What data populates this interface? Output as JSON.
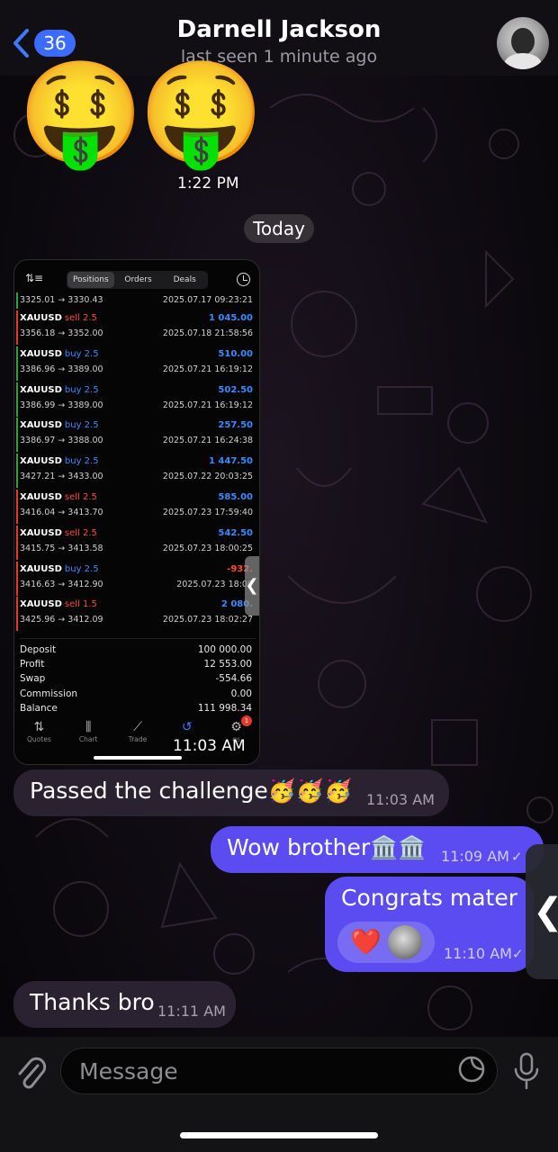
{
  "header": {
    "back_count": "36",
    "contact_name": "Darnell Jackson",
    "status": "last seen 1 minute ago",
    "avatar_icon": "contact-avatar"
  },
  "stickers": [
    "🤑",
    "🤑"
  ],
  "sticker_time": "1:22 PM",
  "date_divider": "Today",
  "photo_message": {
    "time": "11:03 AM",
    "tabs": [
      "Positions",
      "Orders",
      "Deals"
    ],
    "first_row": {
      "prices": "3325.01 → 3330.43",
      "date": "2025.07.17 09:23:21",
      "edge": "#2ea043"
    },
    "trades": [
      {
        "symbol": "XAUUSD",
        "dir": "sell 2.5",
        "dir_color": "#ff4b3e",
        "profit": "1 045.00",
        "profit_color": "#3b8bff",
        "prices": "3356.18 → 3352.00",
        "date": "2025.07.18 21:58:56",
        "edge": "#e5372c"
      },
      {
        "symbol": "XAUUSD",
        "dir": "buy 2.5",
        "dir_color": "#3b8bff",
        "profit": "510.00",
        "profit_color": "#3b8bff",
        "prices": "3386.96 → 3389.00",
        "date": "2025.07.21 16:19:12",
        "edge": "#2ea043"
      },
      {
        "symbol": "XAUUSD",
        "dir": "buy 2.5",
        "dir_color": "#3b8bff",
        "profit": "502.50",
        "profit_color": "#3b8bff",
        "prices": "3386.99 → 3389.00",
        "date": "2025.07.21 16:19:12",
        "edge": "#2ea043"
      },
      {
        "symbol": "XAUUSD",
        "dir": "buy 2.5",
        "dir_color": "#3b8bff",
        "profit": "257.50",
        "profit_color": "#3b8bff",
        "prices": "3386.97 → 3388.00",
        "date": "2025.07.21 16:24:38",
        "edge": "#2ea043"
      },
      {
        "symbol": "XAUUSD",
        "dir": "buy 2.5",
        "dir_color": "#3b8bff",
        "profit": "1 447.50",
        "profit_color": "#3b8bff",
        "prices": "3427.21 → 3433.00",
        "date": "2025.07.22 20:03:25",
        "edge": "#2ea043"
      },
      {
        "symbol": "XAUUSD",
        "dir": "sell 2.5",
        "dir_color": "#ff4b3e",
        "profit": "585.00",
        "profit_color": "#3b8bff",
        "prices": "3416.04 → 3413.70",
        "date": "2025.07.23 17:59:40",
        "edge": "#e5372c"
      },
      {
        "symbol": "XAUUSD",
        "dir": "sell 2.5",
        "dir_color": "#ff4b3e",
        "profit": "542.50",
        "profit_color": "#3b8bff",
        "prices": "3415.75 → 3413.58",
        "date": "2025.07.23 18:00:25",
        "edge": "#e5372c"
      },
      {
        "symbol": "XAUUSD",
        "dir": "buy 2.5",
        "dir_color": "#3b8bff",
        "profit": "-932.",
        "profit_color": "#ff4b3e",
        "prices": "3416.63 → 3412.90",
        "date": "2025.07.23 18:00",
        "edge": "#e5372c"
      },
      {
        "symbol": "XAUUSD",
        "dir": "sell 1.5",
        "dir_color": "#ff4b3e",
        "profit": "2 080.",
        "profit_color": "#3b8bff",
        "prices": "3425.96 → 3412.09",
        "date": "2025.07.23 18:02:27",
        "edge": "#e5372c"
      }
    ],
    "summary": [
      {
        "label": "Deposit",
        "value": "100 000.00"
      },
      {
        "label": "Profit",
        "value": "12 553.00"
      },
      {
        "label": "Swap",
        "value": "-554.66"
      },
      {
        "label": "Commission",
        "value": "0.00"
      },
      {
        "label": "Balance",
        "value": "111 998.34"
      }
    ],
    "tabbar": [
      {
        "label": "Quotes",
        "icon": "quotes-icon",
        "glyph": "⇅"
      },
      {
        "label": "Chart",
        "icon": "chart-icon",
        "glyph": "⫼"
      },
      {
        "label": "Trade",
        "icon": "trade-icon",
        "glyph": "⟋"
      },
      {
        "label": "History",
        "icon": "history-icon",
        "glyph": "↺"
      },
      {
        "label": "gs",
        "icon": "settings-icon",
        "glyph": "⚙",
        "badge": "1"
      }
    ]
  },
  "messages": [
    {
      "text": "Passed the challenge🥳🥳🥳",
      "time": "11:03 AM",
      "dir": "in"
    },
    {
      "text": "Wow brother🏛️🏛️",
      "time": "11:09 AM",
      "dir": "out"
    },
    {
      "text": "Congrats mater",
      "time": "11:10 AM",
      "dir": "out",
      "reaction": "❤️"
    },
    {
      "text": "Thanks bro",
      "time": "11:11 AM",
      "dir": "in"
    }
  ],
  "input": {
    "placeholder": "Message"
  },
  "colors": {
    "outgoing": "#5a4cf0",
    "incoming": "#2a2230",
    "accent": "#3b6cff"
  }
}
